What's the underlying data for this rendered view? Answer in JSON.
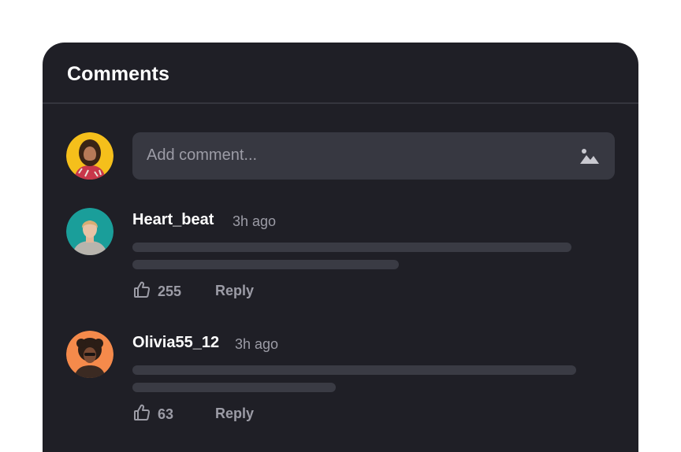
{
  "panel": {
    "title": "Comments"
  },
  "composer": {
    "placeholder": "Add comment...",
    "avatar_color": "#f5bf1b"
  },
  "comments": [
    {
      "author": "Heart_beat",
      "time": "3h ago",
      "likes": "255",
      "reply_label": "Reply",
      "avatar_color": "#1a9e9a"
    },
    {
      "author": "Olivia55_12",
      "time": "3h ago",
      "likes": "63",
      "reply_label": "Reply",
      "avatar_color": "#f58a4b"
    }
  ],
  "icons": {
    "image": "image-icon",
    "like": "thumbs-up-icon"
  },
  "colors": {
    "panel_bg": "#1f1f26",
    "input_bg": "#373841",
    "text_muted": "#9c9ca6",
    "skeleton": "#3a3b44"
  }
}
